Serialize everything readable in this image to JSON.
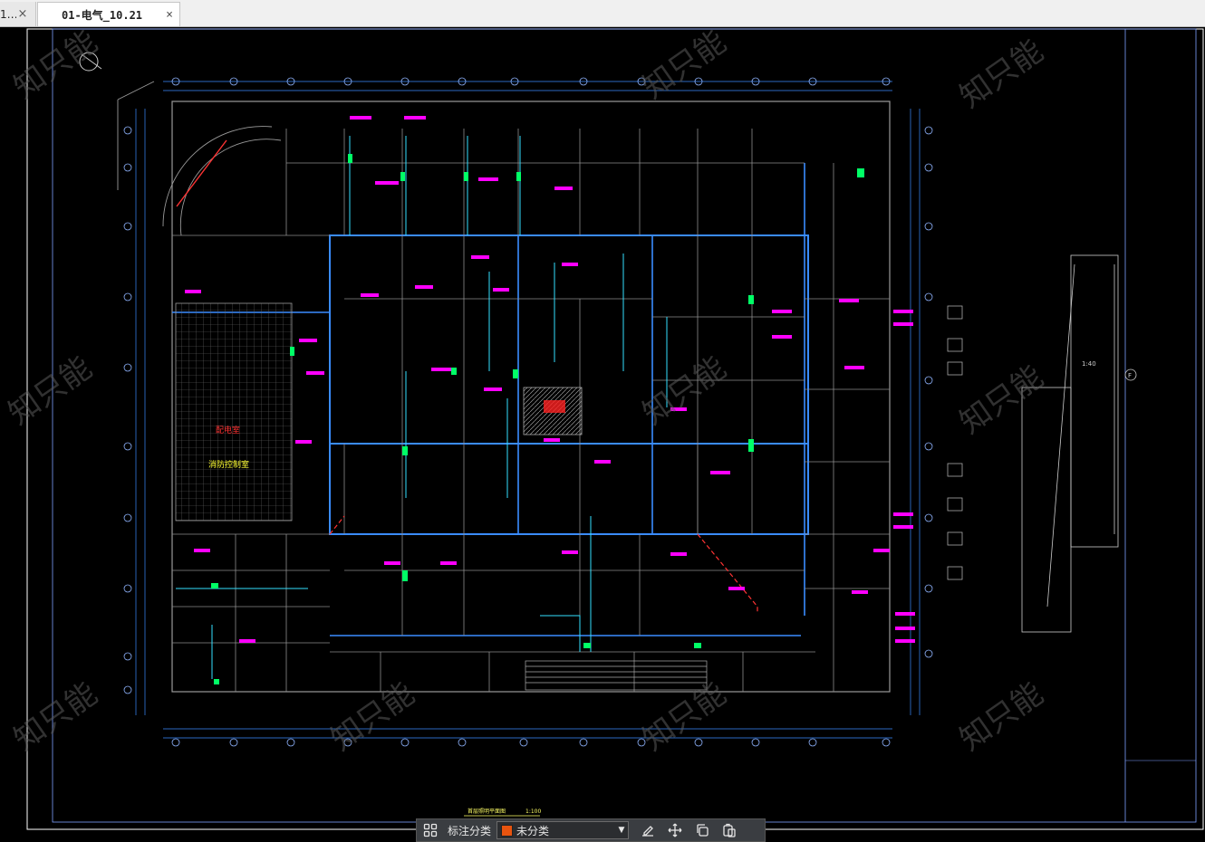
{
  "tabs": [
    {
      "label": "1…",
      "active": false
    },
    {
      "label": "01-电气_10.21",
      "active": true
    }
  ],
  "close_glyph": "×",
  "drawing": {
    "background": "#000000",
    "frame_color": "#ffffff",
    "axis_color": "#3a8cff",
    "wall_color": "#9a9a9a",
    "annotation_color": "#ff00ff",
    "highlight_color": "#00ff66",
    "title_text": "首层照明平面图",
    "scale_text": "1:100",
    "legend_text": "1:40",
    "watermark_text": "知只能",
    "axis_letter_right": "F",
    "red_label": "配电室",
    "yellow_label": "消防控制室"
  },
  "toolbar": {
    "grid_icon": "grid-icon",
    "category_label": "标注分类",
    "category_value": "未分类",
    "category_color": "#e8540f",
    "edit_icon": "edit-icon",
    "move_icon": "move-icon",
    "copy_icon": "copy-icon",
    "paste_icon": "paste-icon"
  }
}
